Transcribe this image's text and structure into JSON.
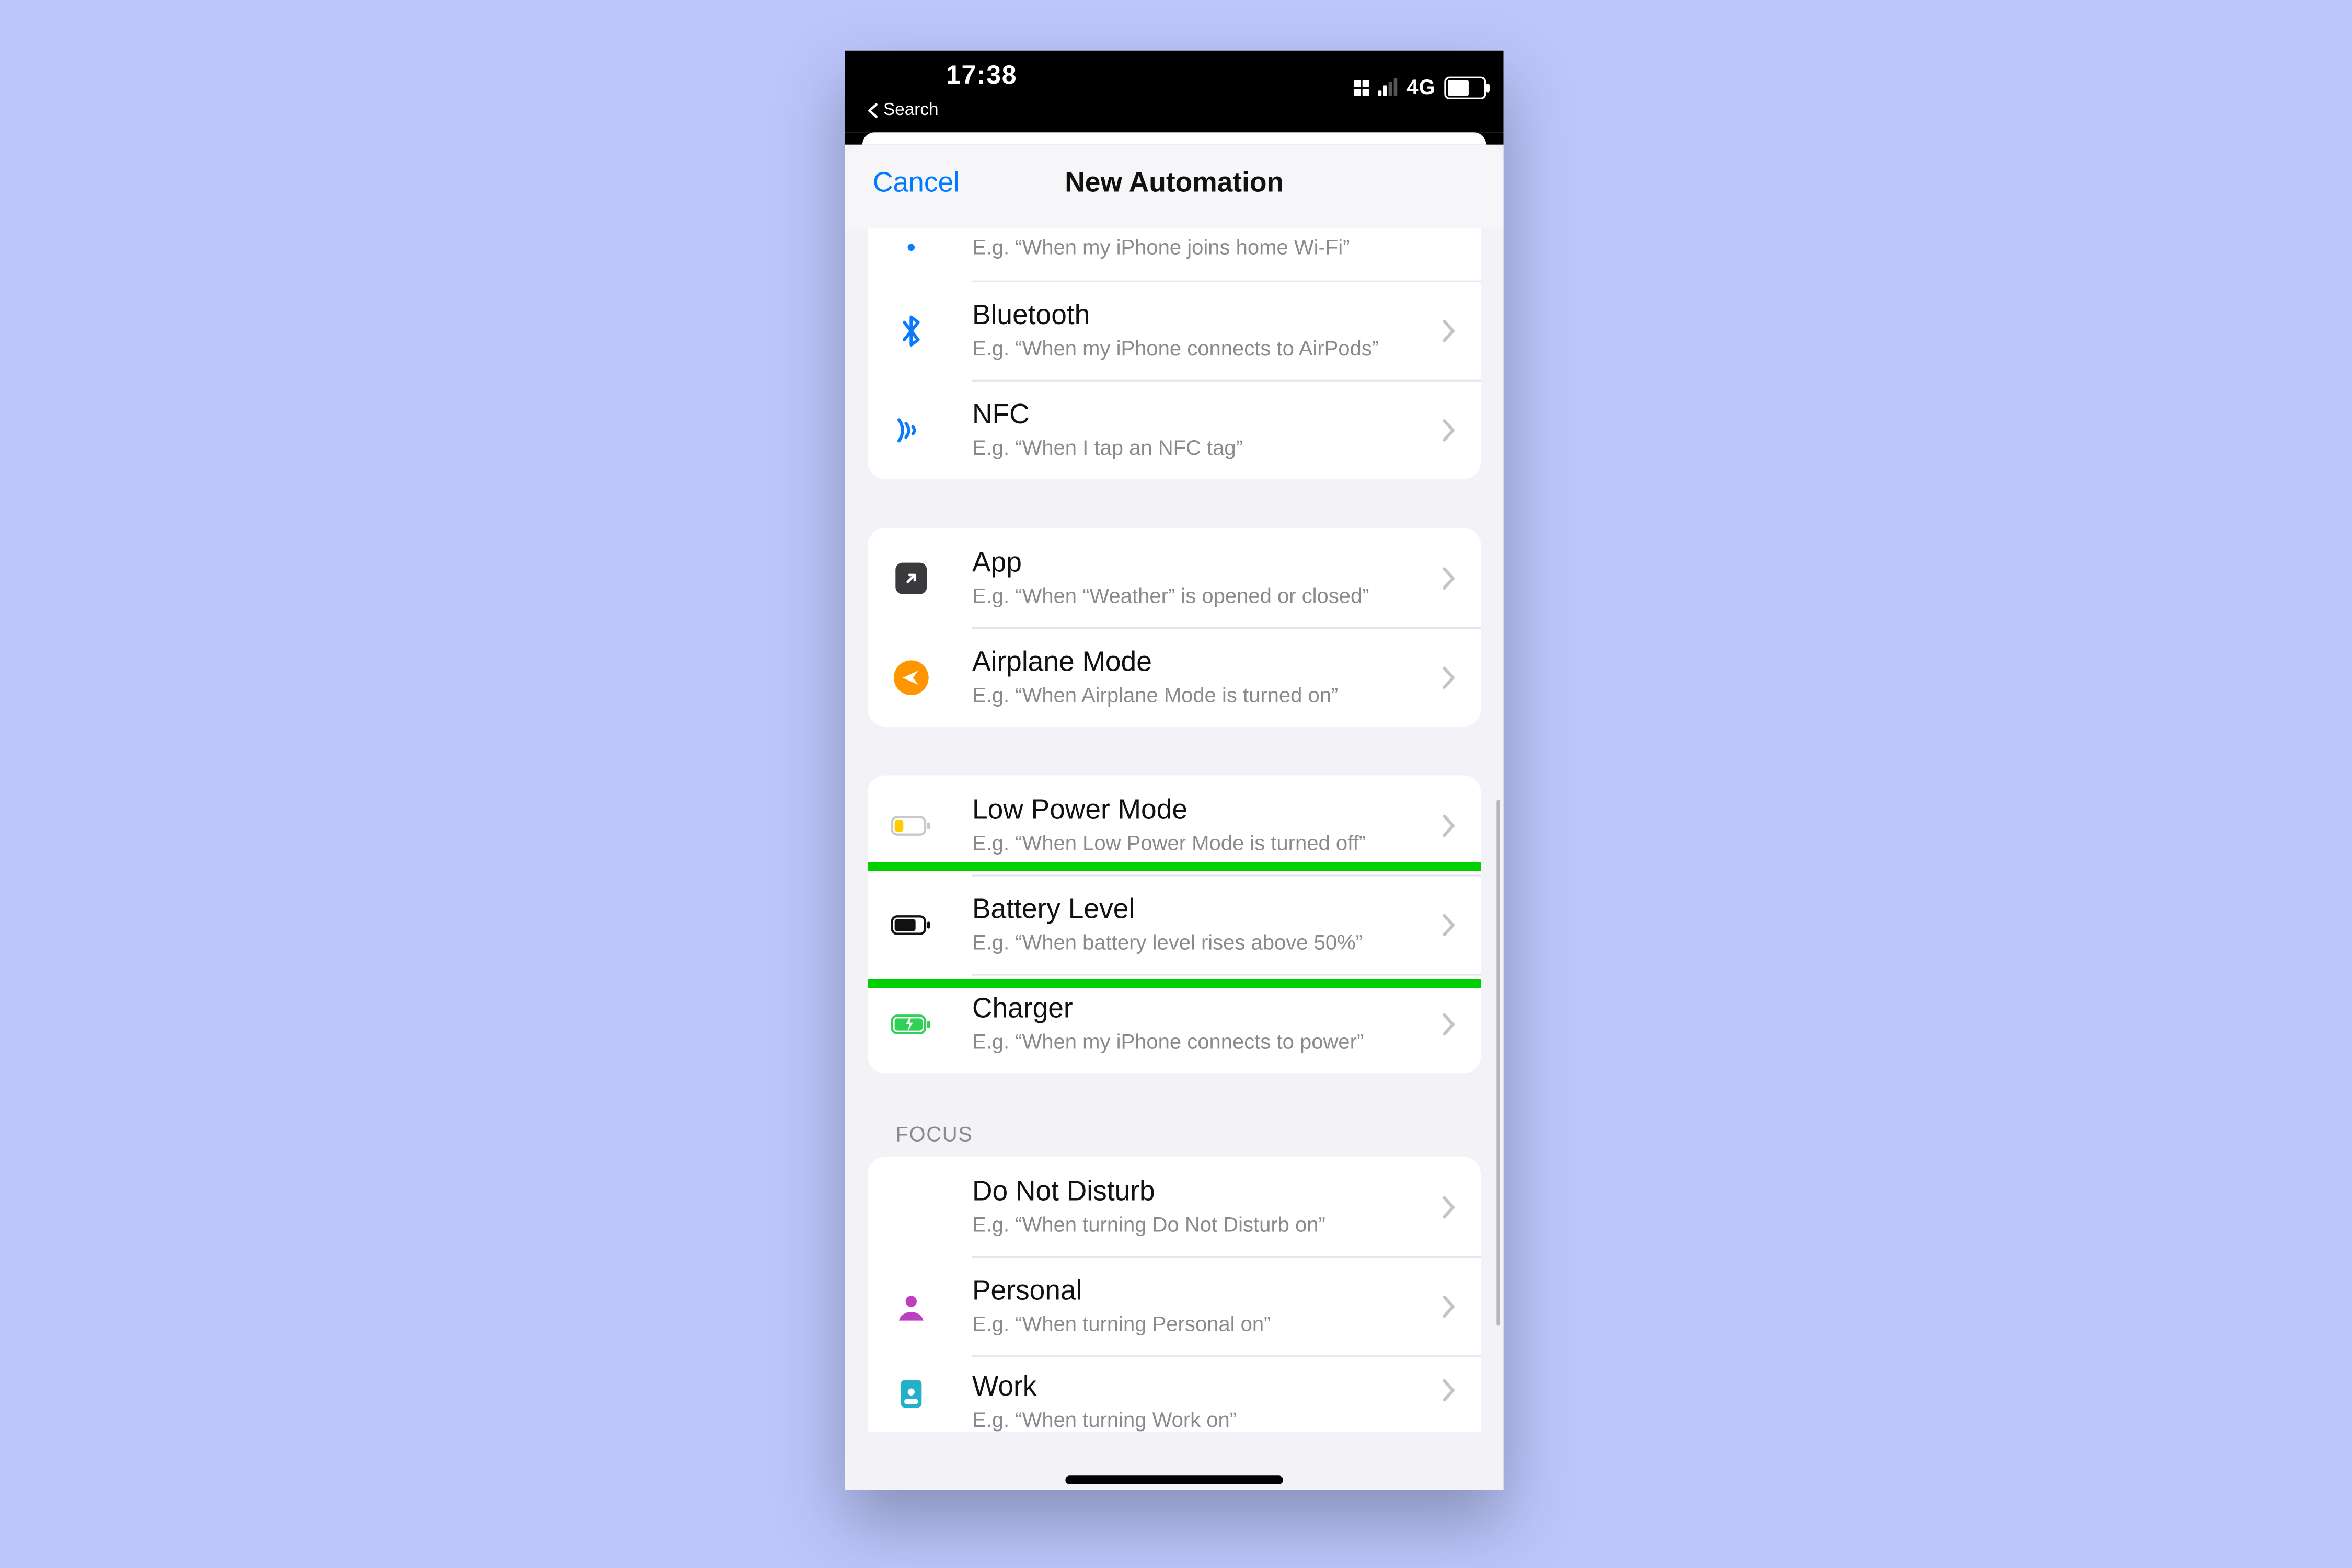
{
  "status": {
    "time": "17:38",
    "back": "Search",
    "network": "4G"
  },
  "modal": {
    "cancel": "Cancel",
    "title": "New Automation"
  },
  "groups": {
    "connectivity": {
      "wifi_partial": {
        "sub": "E.g. “When my iPhone joins home Wi-Fi”"
      },
      "bluetooth": {
        "title": "Bluetooth",
        "sub": "E.g. “When my iPhone connects to AirPods”"
      },
      "nfc": {
        "title": "NFC",
        "sub": "E.g. “When I tap an NFC tag”"
      }
    },
    "system": {
      "app": {
        "title": "App",
        "sub": "E.g. “When “Weather” is opened or closed”"
      },
      "airplane": {
        "title": "Airplane Mode",
        "sub": "E.g. “When Airplane Mode is turned on”"
      }
    },
    "power": {
      "lpm": {
        "title": "Low Power Mode",
        "sub": "E.g. “When Low Power Mode is turned off”"
      },
      "battery": {
        "title": "Battery Level",
        "sub": "E.g. “When battery level rises above 50%”"
      },
      "charger": {
        "title": "Charger",
        "sub": "E.g. “When my iPhone connects to power”"
      }
    },
    "focus_header": "FOCUS",
    "focus": {
      "dnd": {
        "title": "Do Not Disturb",
        "sub": "E.g. “When turning Do Not Disturb on”"
      },
      "personal": {
        "title": "Personal",
        "sub": "E.g. “When turning Personal on”"
      },
      "work": {
        "title": "Work",
        "sub": "E.g. “When turning Work on”"
      }
    }
  },
  "highlight": "battery"
}
